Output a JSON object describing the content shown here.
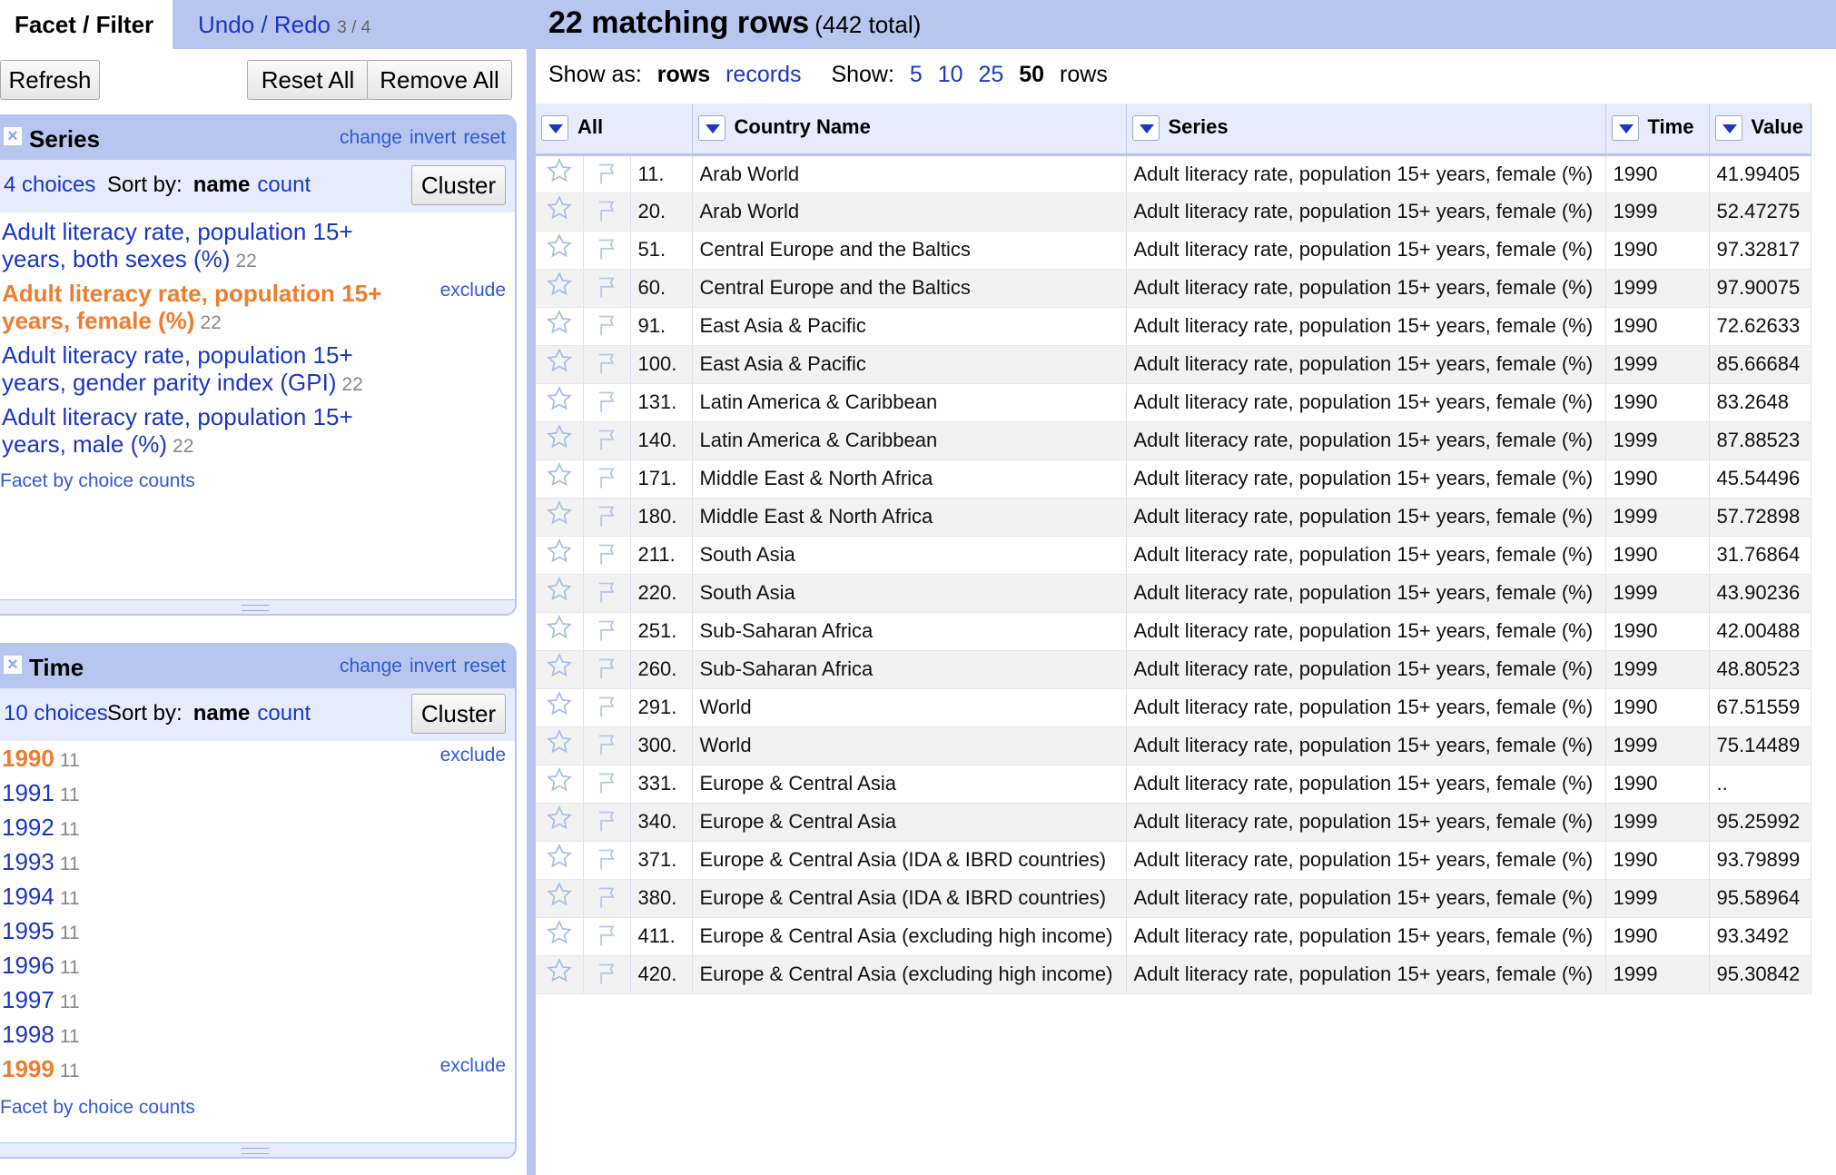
{
  "left": {
    "tabs": {
      "facet_filter": "Facet / Filter",
      "undo_redo": "Undo / Redo",
      "undo_count": "3 / 4"
    },
    "buttons": {
      "refresh": "Refresh",
      "reset_all": "Reset All",
      "remove_all": "Remove All"
    },
    "actions": {
      "change": "change",
      "invert": "invert",
      "reset": "reset"
    },
    "sort": {
      "label": "Sort by:",
      "name": "name",
      "count": "count",
      "cluster": "Cluster"
    },
    "exclude": "exclude",
    "facet_by_counts": "Facet by choice counts",
    "series_facet": {
      "title": "Series",
      "choices_count": "4 choices",
      "choices": [
        {
          "label": "Adult literacy rate, population 15+ years, both sexes (%)",
          "count": "22",
          "selected": false
        },
        {
          "label": "Adult literacy rate, population 15+ years, female (%)",
          "count": "22",
          "selected": true
        },
        {
          "label": "Adult literacy rate, population 15+ years, gender parity index (GPI)",
          "count": "22",
          "selected": false
        },
        {
          "label": "Adult literacy rate, population 15+ years, male (%)",
          "count": "22",
          "selected": false
        }
      ]
    },
    "time_facet": {
      "title": "Time",
      "choices_count": "10 choices",
      "choices": [
        {
          "label": "1990",
          "count": "11",
          "selected": true
        },
        {
          "label": "1991",
          "count": "11",
          "selected": false
        },
        {
          "label": "1992",
          "count": "11",
          "selected": false
        },
        {
          "label": "1993",
          "count": "11",
          "selected": false
        },
        {
          "label": "1994",
          "count": "11",
          "selected": false
        },
        {
          "label": "1995",
          "count": "11",
          "selected": false
        },
        {
          "label": "1996",
          "count": "11",
          "selected": false
        },
        {
          "label": "1997",
          "count": "11",
          "selected": false
        },
        {
          "label": "1998",
          "count": "11",
          "selected": false
        },
        {
          "label": "1999",
          "count": "11",
          "selected": true
        }
      ]
    }
  },
  "summary": {
    "matching": "22 matching rows",
    "total": "(442 total)"
  },
  "viewbar": {
    "show_as": "Show as:",
    "rows": "rows",
    "records": "records",
    "show": "Show:",
    "sizes": [
      "5",
      "10",
      "25",
      "50"
    ],
    "active_size": "50",
    "rows_suffix": "rows"
  },
  "columns": [
    "All",
    "Country Name",
    "Series",
    "Time",
    "Value"
  ],
  "rows": [
    {
      "num": "11.",
      "country": "Arab World",
      "series": "Adult literacy rate, population 15+ years, female (%)",
      "time": "1990",
      "value": "41.99405"
    },
    {
      "num": "20.",
      "country": "Arab World",
      "series": "Adult literacy rate, population 15+ years, female (%)",
      "time": "1999",
      "value": "52.47275"
    },
    {
      "num": "51.",
      "country": "Central Europe and the Baltics",
      "series": "Adult literacy rate, population 15+ years, female (%)",
      "time": "1990",
      "value": "97.32817"
    },
    {
      "num": "60.",
      "country": "Central Europe and the Baltics",
      "series": "Adult literacy rate, population 15+ years, female (%)",
      "time": "1999",
      "value": "97.90075"
    },
    {
      "num": "91.",
      "country": "East Asia & Pacific",
      "series": "Adult literacy rate, population 15+ years, female (%)",
      "time": "1990",
      "value": "72.62633"
    },
    {
      "num": "100.",
      "country": "East Asia & Pacific",
      "series": "Adult literacy rate, population 15+ years, female (%)",
      "time": "1999",
      "value": "85.66684"
    },
    {
      "num": "131.",
      "country": "Latin America & Caribbean",
      "series": "Adult literacy rate, population 15+ years, female (%)",
      "time": "1990",
      "value": "83.2648"
    },
    {
      "num": "140.",
      "country": "Latin America & Caribbean",
      "series": "Adult literacy rate, population 15+ years, female (%)",
      "time": "1999",
      "value": "87.88523"
    },
    {
      "num": "171.",
      "country": "Middle East & North Africa",
      "series": "Adult literacy rate, population 15+ years, female (%)",
      "time": "1990",
      "value": "45.54496"
    },
    {
      "num": "180.",
      "country": "Middle East & North Africa",
      "series": "Adult literacy rate, population 15+ years, female (%)",
      "time": "1999",
      "value": "57.72898"
    },
    {
      "num": "211.",
      "country": "South Asia",
      "series": "Adult literacy rate, population 15+ years, female (%)",
      "time": "1990",
      "value": "31.76864"
    },
    {
      "num": "220.",
      "country": "South Asia",
      "series": "Adult literacy rate, population 15+ years, female (%)",
      "time": "1999",
      "value": "43.90236"
    },
    {
      "num": "251.",
      "country": "Sub-Saharan Africa",
      "series": "Adult literacy rate, population 15+ years, female (%)",
      "time": "1990",
      "value": "42.00488"
    },
    {
      "num": "260.",
      "country": "Sub-Saharan Africa",
      "series": "Adult literacy rate, population 15+ years, female (%)",
      "time": "1999",
      "value": "48.80523"
    },
    {
      "num": "291.",
      "country": "World",
      "series": "Adult literacy rate, population 15+ years, female (%)",
      "time": "1990",
      "value": "67.51559"
    },
    {
      "num": "300.",
      "country": "World",
      "series": "Adult literacy rate, population 15+ years, female (%)",
      "time": "1999",
      "value": "75.14489"
    },
    {
      "num": "331.",
      "country": "Europe & Central Asia",
      "series": "Adult literacy rate, population 15+ years, female (%)",
      "time": "1990",
      "value": ".."
    },
    {
      "num": "340.",
      "country": "Europe & Central Asia",
      "series": "Adult literacy rate, population 15+ years, female (%)",
      "time": "1999",
      "value": "95.25992"
    },
    {
      "num": "371.",
      "country": "Europe & Central Asia (IDA & IBRD countries)",
      "series": "Adult literacy rate, population 15+ years, female (%)",
      "time": "1990",
      "value": "93.79899"
    },
    {
      "num": "380.",
      "country": "Europe & Central Asia (IDA & IBRD countries)",
      "series": "Adult literacy rate, population 15+ years, female (%)",
      "time": "1999",
      "value": "95.58964"
    },
    {
      "num": "411.",
      "country": "Europe & Central Asia (excluding high income)",
      "series": "Adult literacy rate, population 15+ years, female (%)",
      "time": "1990",
      "value": "93.3492"
    },
    {
      "num": "420.",
      "country": "Europe & Central Asia (excluding high income)",
      "series": "Adult literacy rate, population 15+ years, female (%)",
      "time": "1999",
      "value": "95.30842"
    }
  ]
}
